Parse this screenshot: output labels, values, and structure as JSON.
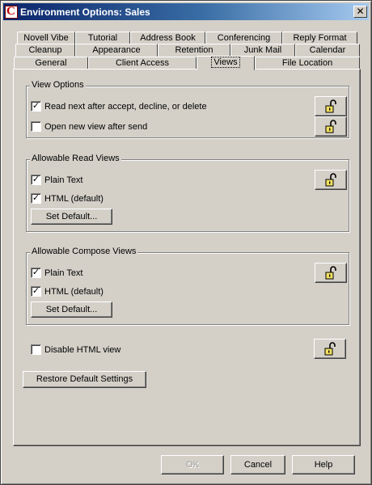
{
  "window": {
    "title": "Environment Options:  Sales",
    "icon_letter": "C",
    "close_glyph": "✕"
  },
  "tabs": {
    "row1": [
      "Novell Vibe",
      "Tutorial",
      "Address Book",
      "Conferencing",
      "Reply Format"
    ],
    "row2": [
      "Cleanup",
      "Appearance",
      "Retention",
      "Junk Mail",
      "Calendar"
    ],
    "row3": [
      "General",
      "Client Access",
      "Views",
      "File Location"
    ],
    "active": "Views"
  },
  "view_options": {
    "title": "View Options",
    "read_next": {
      "label": "Read next after accept, decline, or delete",
      "checked": true
    },
    "open_new_view": {
      "label": "Open new view after send",
      "checked": false
    }
  },
  "read_views": {
    "title": "Allowable Read Views",
    "plain_text": {
      "label": "Plain Text",
      "checked": true
    },
    "html": {
      "label": "HTML  (default)",
      "checked": true
    },
    "set_default_label": "Set Default..."
  },
  "compose_views": {
    "title": "Allowable Compose Views",
    "plain_text": {
      "label": "Plain Text",
      "checked": true
    },
    "html": {
      "label": "HTML  (default)",
      "checked": true
    },
    "set_default_label": "Set Default..."
  },
  "disable_html": {
    "label": "Disable HTML view",
    "checked": false
  },
  "restore_defaults_label": "Restore Default Settings",
  "footer": {
    "ok_label": "OK",
    "cancel_label": "Cancel",
    "help_label": "Help"
  },
  "icons": {
    "lock": "padlock-unlocked-icon",
    "check": "✓"
  },
  "colors": {
    "titlebar_start": "#0a246a",
    "titlebar_end": "#a6caf0",
    "face": "#d4d0c8",
    "lock_yellow": "#f0e060"
  }
}
